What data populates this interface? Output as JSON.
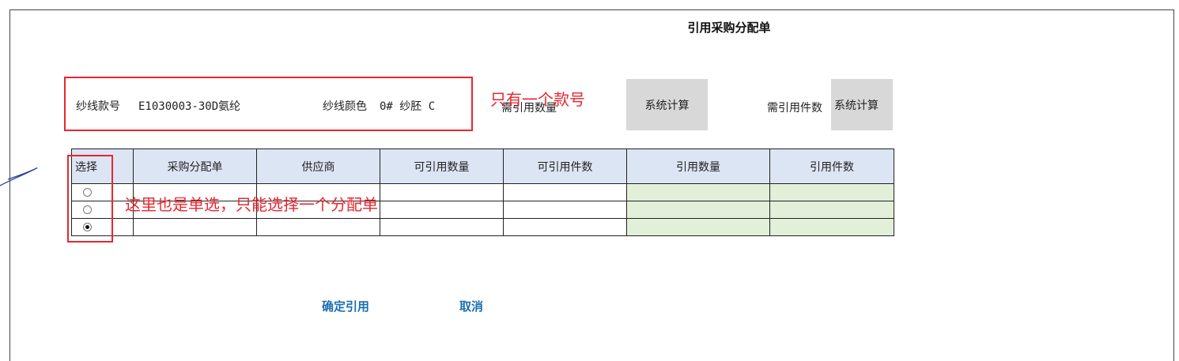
{
  "title": "引用采购分配单",
  "form": {
    "yarn_style_label": "纱线款号",
    "yarn_style_value": "E1030003-30D氨纶",
    "yarn_color_label": "纱线颜色",
    "yarn_color_value": "0# 纱胚 C",
    "need_qty_label": "需引用数量",
    "need_qty_btn": "系统计算",
    "need_pieces_label": "需引用件数",
    "need_pieces_btn": "系统计算"
  },
  "annotations": {
    "style_note": "只有一个款号",
    "radio_note": "这里也是单选，只能选择一个分配单"
  },
  "table": {
    "headers": [
      "选择",
      "采购分配单",
      "供应商",
      "可引用数量",
      "可引用件数",
      "引用数量",
      "引用件数"
    ],
    "rows": [
      {
        "selected": false
      },
      {
        "selected": false
      },
      {
        "selected": true
      }
    ]
  },
  "actions": {
    "confirm": "确定引用",
    "cancel": "取消"
  },
  "colors": {
    "header_bg": "#dce5f4",
    "editable_bg": "#e2efd9",
    "annotation": "#e8262e",
    "link": "#1a6fb3"
  }
}
